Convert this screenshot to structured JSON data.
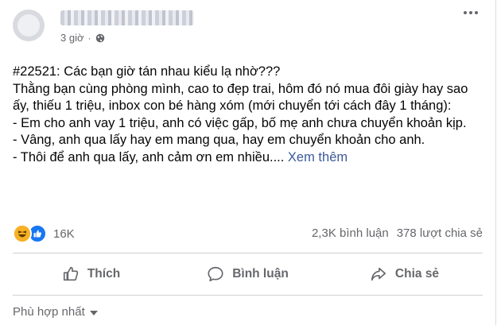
{
  "header": {
    "time": "3 giờ",
    "separator": "·"
  },
  "post": {
    "lines": [
      "#22521: Các bạn giờ tán nhau kiểu lạ nhờ???",
      "Thằng bạn cùng phòng mình, cao to đẹp trai, hôm đó nó mua đôi giày hay sao ấy, thiếu 1 triệu, inbox con bé hàng xóm (mới chuyển tới cách đây 1 tháng):",
      "- Em cho anh vay 1 triệu, anh có việc gấp, bố mẹ anh chưa chuyển khoản kịp.",
      "- Vâng, anh qua lấy hay em mang qua, hay em chuyển khoản cho anh.",
      "- Thôi để anh qua lấy, anh cảm ơn em nhiều...."
    ],
    "see_more": "Xem thêm"
  },
  "stats": {
    "reactions": "16K",
    "comments": "2,3K bình luận",
    "shares": "378 lượt chia sẻ"
  },
  "actions": {
    "like": "Thích",
    "comment": "Bình luận",
    "share": "Chia sẻ"
  },
  "sort": {
    "label": "Phù hợp nhất"
  },
  "icons": {
    "globe": "globe-icon",
    "more": "more-icon",
    "haha": "haha-reaction-icon",
    "like_reaction": "like-reaction-icon",
    "like_action": "thumbs-up-icon",
    "comment_action": "comment-bubble-icon",
    "share_action": "share-arrow-icon",
    "caret": "caret-down-icon"
  },
  "colors": {
    "like_blue": "#1877f2",
    "haha_yellow": "#f7b125",
    "secondary_text": "#65676b",
    "see_more": "#3b5998"
  }
}
